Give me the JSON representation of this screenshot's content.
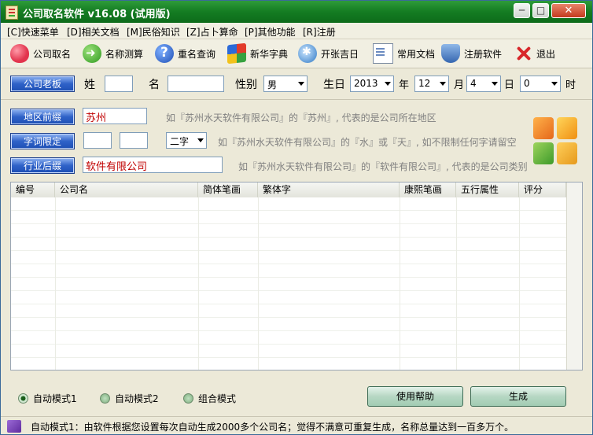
{
  "window": {
    "title": "公司取名软件 v16.08 (试用版)",
    "minimize": "─",
    "maximize": "□",
    "close": "✕"
  },
  "menu": [
    "[C]快速菜单",
    "[D]相关文档",
    "[M]民俗知识",
    "[Z]占卜算命",
    "[P]其他功能",
    "[R]注册"
  ],
  "toolbar": [
    {
      "label": "公司取名",
      "icon": "heart-icon"
    },
    {
      "label": "名称测算",
      "icon": "arrow-icon"
    },
    {
      "label": "重名查询",
      "icon": "help-icon"
    },
    {
      "label": "新华字典",
      "icon": "windows-icon"
    },
    {
      "label": "开张吉日",
      "icon": "globe-icon"
    },
    {
      "label": "常用文档",
      "icon": "document-icon"
    },
    {
      "label": "注册软件",
      "icon": "shield-icon"
    },
    {
      "label": "退出",
      "icon": "exit-icon"
    }
  ],
  "owner": {
    "button": "公司老板",
    "surname_label": "姓",
    "surname_value": "",
    "given_label": "名",
    "given_value": "",
    "gender_label": "性别",
    "gender_value": "男",
    "birthday_label": "生日",
    "year_value": "2013",
    "year_unit": "年",
    "month_value": "12",
    "month_unit": "月",
    "day_value": "4",
    "day_unit": "日",
    "hour_value": "0",
    "hour_unit": "时"
  },
  "prefix": {
    "button": "地区前缀",
    "value": "苏州",
    "hint": "如『苏州水天软件有限公司』的『苏州』, 代表的是公司所在地区"
  },
  "charlimit": {
    "button": "字词限定",
    "value1": "",
    "value2": "",
    "select_value": "二字",
    "hint": "如『苏州水天软件有限公司』的『水』或『天』, 如不限制任何字请留空"
  },
  "suffix": {
    "button": "行业后缀",
    "value": "软件有限公司",
    "hint": "如『苏州水天软件有限公司』的『软件有限公司』, 代表的是公司类别"
  },
  "grid": {
    "columns": [
      "编号",
      "公司名",
      "简体笔画",
      "繁体字",
      "康熙笔画",
      "五行属性",
      "评分"
    ],
    "rows": []
  },
  "modes": [
    {
      "label": "自动模式1",
      "selected": true
    },
    {
      "label": "自动模式2",
      "selected": false
    },
    {
      "label": "组合模式",
      "selected": false
    }
  ],
  "buttons": {
    "help": "使用帮助",
    "generate": "生成"
  },
  "status": {
    "text": "自动模式1：由软件根据您设置每次自动生成2000多个公司名；觉得不满意可重复生成，名称总量达到一百多万个。"
  },
  "colors": {
    "titlebar": "#147c22",
    "button_blue": "#2f62c8",
    "input_text_red": "#c00000"
  }
}
